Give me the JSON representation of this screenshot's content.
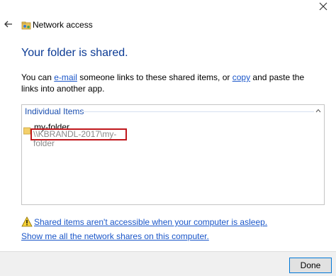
{
  "window": {
    "title": "Network access",
    "back_icon": "back-arrow-icon",
    "close_icon": "close-icon",
    "title_icon": "network-share-icon"
  },
  "main": {
    "heading": "Your folder is shared.",
    "description": {
      "part1": "You can ",
      "email_link": "e-mail",
      "part2": " someone links to these shared items, or ",
      "copy_link": "copy",
      "part3": " and paste the links into another app."
    }
  },
  "items": {
    "header": "Individual Items",
    "collapse_icon": "chevron-up-icon",
    "list": [
      {
        "icon": "folder-icon",
        "name": "my-folder",
        "path": "\\\\KBRANDL-2017\\my-folder"
      }
    ]
  },
  "links": {
    "warning_icon": "warning-icon",
    "warning": "Shared items aren't accessible when your computer is asleep.",
    "show_shares": "Show me all the network shares on this computer."
  },
  "footer": {
    "done_label": "Done"
  },
  "colors": {
    "heading": "#0b3a94",
    "link": "#1a56c9",
    "highlight_border": "#c0171c",
    "button_border": "#0078d7"
  }
}
